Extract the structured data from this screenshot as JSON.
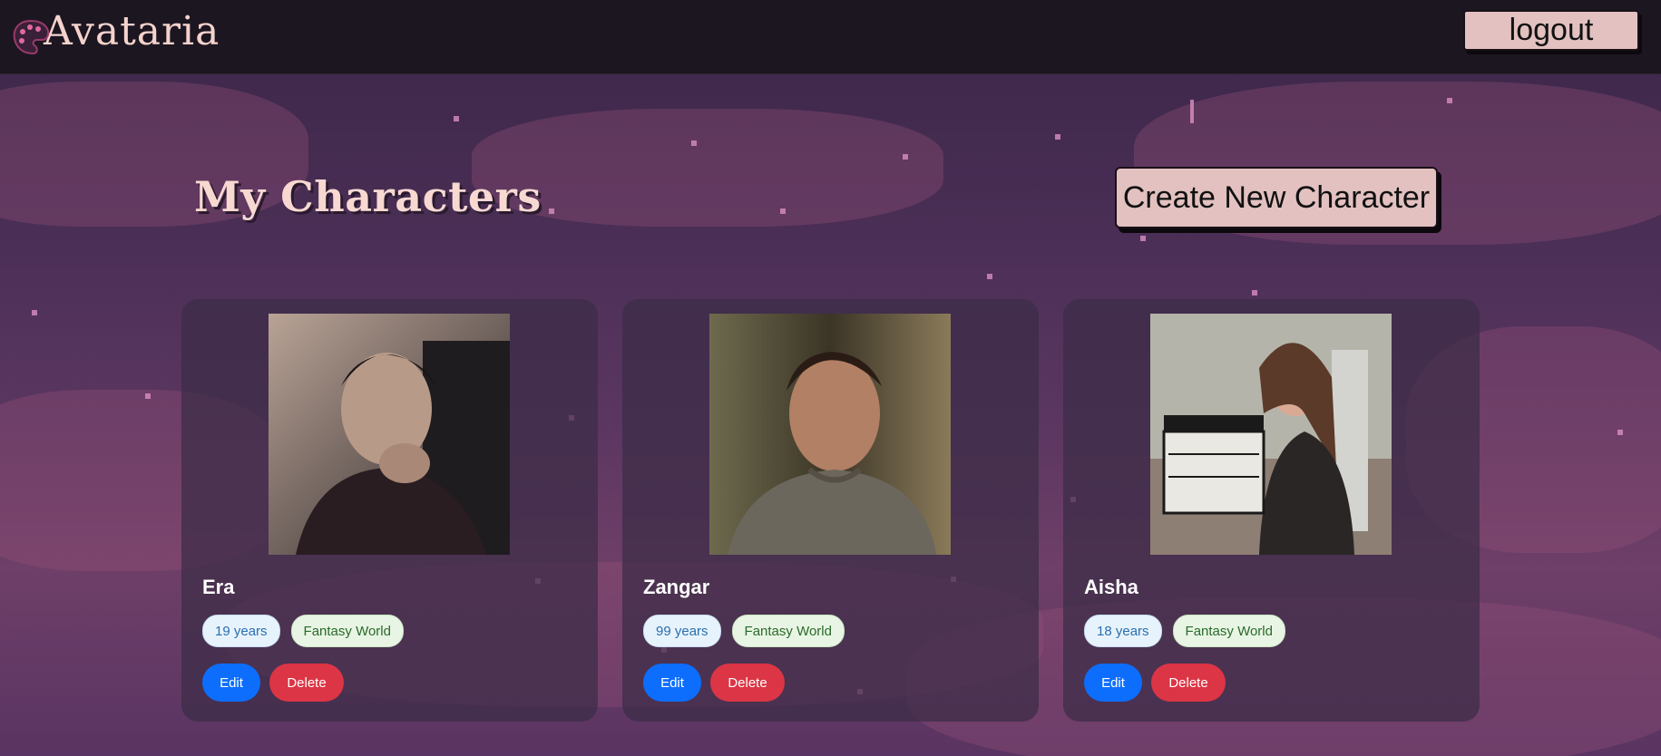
{
  "app": {
    "name": "Avataria"
  },
  "header": {
    "logout_label": "logout"
  },
  "main": {
    "title": "My Characters",
    "create_label": "Create New Character"
  },
  "characters": [
    {
      "name": "Era",
      "age": "19 years",
      "world": "Fantasy World",
      "edit_label": "Edit",
      "delete_label": "Delete"
    },
    {
      "name": "Zangar",
      "age": "99 years",
      "world": "Fantasy World",
      "edit_label": "Edit",
      "delete_label": "Delete"
    },
    {
      "name": "Aisha",
      "age": "18 years",
      "world": "Fantasy World",
      "edit_label": "Edit",
      "delete_label": "Delete"
    }
  ],
  "colors": {
    "accent_pink": "#e2c1c0",
    "edit_blue": "#0d6efd",
    "delete_red": "#dc3545",
    "navbar": "#1c1621"
  }
}
